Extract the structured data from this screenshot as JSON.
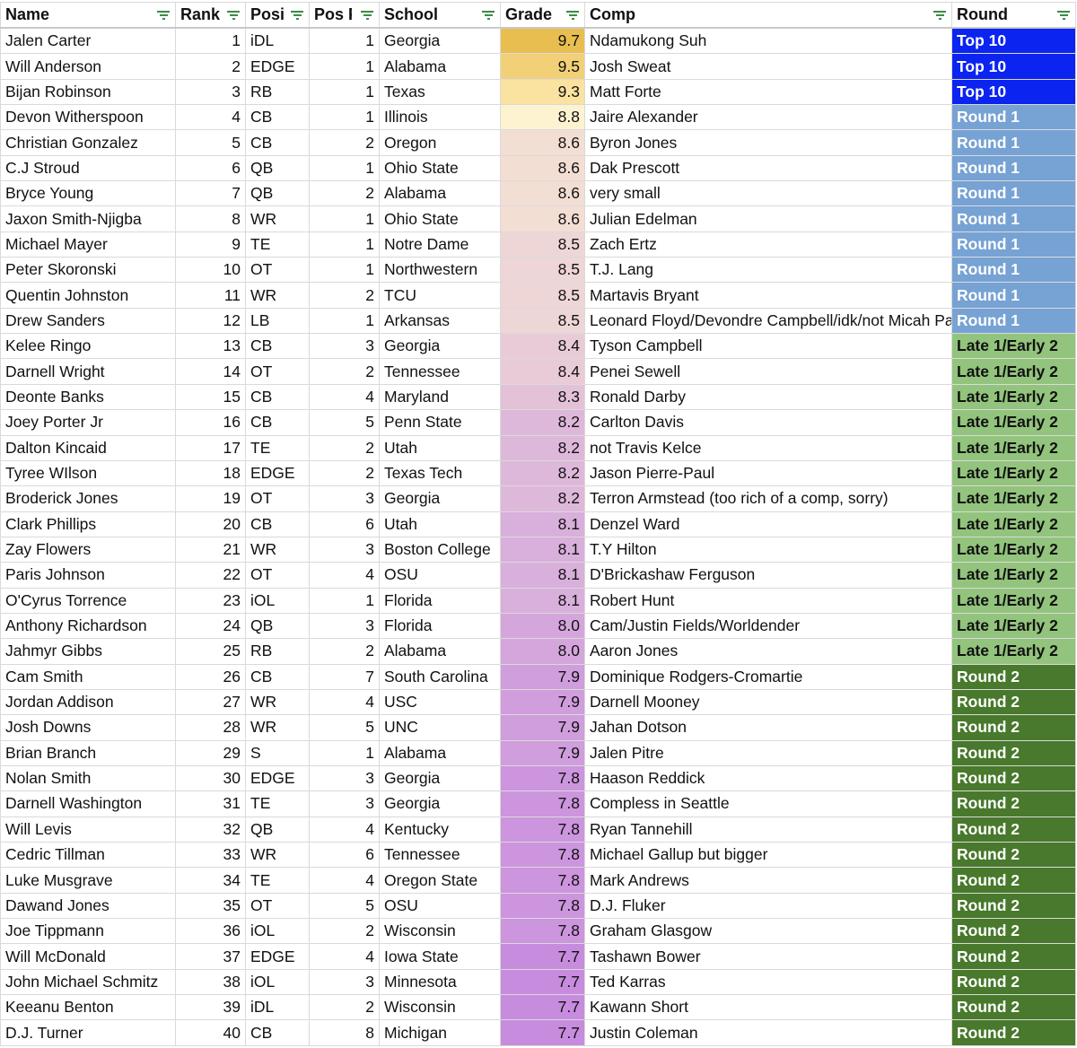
{
  "headers": {
    "name": "Name",
    "rank": "Rank",
    "position": "Posi",
    "pos_rank": "Pos F",
    "school": "School",
    "grade": "Grade",
    "comp": "Comp",
    "round": "Round"
  },
  "round_colors": {
    "Top 10": "#0b24f0",
    "Round 1": "#77a2d4",
    "Late 1/Early 2": "#93c47d",
    "Round 2": "#48792c"
  },
  "rows": [
    {
      "name": "Jalen Carter",
      "rank": "1",
      "pos": "iDL",
      "pos_rank": "1",
      "school": "Georgia",
      "grade": "9.7",
      "comp": "Ndamukong Suh",
      "round": "Top 10"
    },
    {
      "name": "Will Anderson",
      "rank": "2",
      "pos": "EDGE",
      "pos_rank": "1",
      "school": "Alabama",
      "grade": "9.5",
      "comp": "Josh Sweat",
      "round": "Top 10"
    },
    {
      "name": "Bijan Robinson",
      "rank": "3",
      "pos": "RB",
      "pos_rank": "1",
      "school": "Texas",
      "grade": "9.3",
      "comp": "Matt Forte",
      "round": "Top 10"
    },
    {
      "name": "Devon Witherspoon",
      "rank": "4",
      "pos": "CB",
      "pos_rank": "1",
      "school": "Illinois",
      "grade": "8.8",
      "comp": "Jaire Alexander",
      "round": "Round 1"
    },
    {
      "name": "Christian Gonzalez",
      "rank": "5",
      "pos": "CB",
      "pos_rank": "2",
      "school": "Oregon",
      "grade": "8.6",
      "comp": "Byron Jones",
      "round": "Round 1"
    },
    {
      "name": "C.J Stroud",
      "rank": "6",
      "pos": "QB",
      "pos_rank": "1",
      "school": "Ohio State",
      "grade": "8.6",
      "comp": "Dak Prescott",
      "round": "Round 1"
    },
    {
      "name": "Bryce Young",
      "rank": "7",
      "pos": "QB",
      "pos_rank": "2",
      "school": "Alabama",
      "grade": "8.6",
      "comp": "very small",
      "round": "Round 1"
    },
    {
      "name": "Jaxon Smith-Njigba",
      "rank": "8",
      "pos": "WR",
      "pos_rank": "1",
      "school": "Ohio State",
      "grade": "8.6",
      "comp": "Julian Edelman",
      "round": "Round 1"
    },
    {
      "name": "Michael Mayer",
      "rank": "9",
      "pos": "TE",
      "pos_rank": "1",
      "school": "Notre Dame",
      "grade": "8.5",
      "comp": "Zach Ertz",
      "round": "Round 1"
    },
    {
      "name": "Peter Skoronski",
      "rank": "10",
      "pos": "OT",
      "pos_rank": "1",
      "school": "Northwestern",
      "grade": "8.5",
      "comp": "T.J. Lang",
      "round": "Round 1"
    },
    {
      "name": "Quentin Johnston",
      "rank": "11",
      "pos": "WR",
      "pos_rank": "2",
      "school": "TCU",
      "grade": "8.5",
      "comp": "Martavis Bryant",
      "round": "Round 1"
    },
    {
      "name": "Drew Sanders",
      "rank": "12",
      "pos": "LB",
      "pos_rank": "1",
      "school": "Arkansas",
      "grade": "8.5",
      "comp": "Leonard Floyd/Devondre Campbell/idk/not Micah Parsons",
      "round": "Round 1"
    },
    {
      "name": "Kelee Ringo",
      "rank": "13",
      "pos": "CB",
      "pos_rank": "3",
      "school": "Georgia",
      "grade": "8.4",
      "comp": "Tyson Campbell",
      "round": "Late 1/Early 2"
    },
    {
      "name": "Darnell Wright",
      "rank": "14",
      "pos": "OT",
      "pos_rank": "2",
      "school": "Tennessee",
      "grade": "8.4",
      "comp": "Penei Sewell",
      "round": "Late 1/Early 2"
    },
    {
      "name": "Deonte Banks",
      "rank": "15",
      "pos": "CB",
      "pos_rank": "4",
      "school": "Maryland",
      "grade": "8.3",
      "comp": "Ronald Darby",
      "round": "Late 1/Early 2"
    },
    {
      "name": "Joey Porter Jr",
      "rank": "16",
      "pos": "CB",
      "pos_rank": "5",
      "school": "Penn State",
      "grade": "8.2",
      "comp": "Carlton Davis",
      "round": "Late 1/Early 2"
    },
    {
      "name": "Dalton Kincaid",
      "rank": "17",
      "pos": "TE",
      "pos_rank": "2",
      "school": "Utah",
      "grade": "8.2",
      "comp": "not Travis Kelce",
      "round": "Late 1/Early 2"
    },
    {
      "name": "Tyree WIlson",
      "rank": "18",
      "pos": "EDGE",
      "pos_rank": "2",
      "school": "Texas Tech",
      "grade": "8.2",
      "comp": "Jason Pierre-Paul",
      "round": "Late 1/Early 2"
    },
    {
      "name": "Broderick Jones",
      "rank": "19",
      "pos": "OT",
      "pos_rank": "3",
      "school": "Georgia",
      "grade": "8.2",
      "comp": "Terron Armstead (too rich of a comp, sorry)",
      "round": "Late 1/Early 2"
    },
    {
      "name": "Clark Phillips",
      "rank": "20",
      "pos": "CB",
      "pos_rank": "6",
      "school": "Utah",
      "grade": "8.1",
      "comp": "Denzel Ward",
      "round": "Late 1/Early 2"
    },
    {
      "name": "Zay Flowers",
      "rank": "21",
      "pos": "WR",
      "pos_rank": "3",
      "school": "Boston College",
      "grade": "8.1",
      "comp": "T.Y Hilton",
      "round": "Late 1/Early 2"
    },
    {
      "name": "Paris Johnson",
      "rank": "22",
      "pos": "OT",
      "pos_rank": "4",
      "school": "OSU",
      "grade": "8.1",
      "comp": "D'Brickashaw Ferguson",
      "round": "Late 1/Early 2"
    },
    {
      "name": "O'Cyrus Torrence",
      "rank": "23",
      "pos": "iOL",
      "pos_rank": "1",
      "school": "Florida",
      "grade": "8.1",
      "comp": "Robert Hunt",
      "round": "Late 1/Early 2"
    },
    {
      "name": "Anthony Richardson",
      "rank": "24",
      "pos": "QB",
      "pos_rank": "3",
      "school": "Florida",
      "grade": "8.0",
      "comp": "Cam/Justin Fields/Worldender",
      "round": "Late 1/Early 2"
    },
    {
      "name": "Jahmyr Gibbs",
      "rank": "25",
      "pos": "RB",
      "pos_rank": "2",
      "school": "Alabama",
      "grade": "8.0",
      "comp": "Aaron Jones",
      "round": "Late 1/Early 2"
    },
    {
      "name": "Cam Smith",
      "rank": "26",
      "pos": "CB",
      "pos_rank": "7",
      "school": "South Carolina",
      "grade": "7.9",
      "comp": "Dominique Rodgers-Cromartie",
      "round": "Round 2"
    },
    {
      "name": "Jordan Addison",
      "rank": "27",
      "pos": "WR",
      "pos_rank": "4",
      "school": "USC",
      "grade": "7.9",
      "comp": "Darnell Mooney",
      "round": "Round 2"
    },
    {
      "name": "Josh Downs",
      "rank": "28",
      "pos": "WR",
      "pos_rank": "5",
      "school": "UNC",
      "grade": "7.9",
      "comp": "Jahan Dotson",
      "round": "Round 2"
    },
    {
      "name": "Brian Branch",
      "rank": "29",
      "pos": "S",
      "pos_rank": "1",
      "school": "Alabama",
      "grade": "7.9",
      "comp": "Jalen Pitre",
      "round": "Round 2"
    },
    {
      "name": "Nolan Smith",
      "rank": "30",
      "pos": "EDGE",
      "pos_rank": "3",
      "school": "Georgia",
      "grade": "7.8",
      "comp": "Haason Reddick",
      "round": "Round 2"
    },
    {
      "name": "Darnell Washington",
      "rank": "31",
      "pos": "TE",
      "pos_rank": "3",
      "school": "Georgia",
      "grade": "7.8",
      "comp": "Compless in Seattle",
      "round": "Round 2"
    },
    {
      "name": "Will Levis",
      "rank": "32",
      "pos": "QB",
      "pos_rank": "4",
      "school": "Kentucky",
      "grade": "7.8",
      "comp": "Ryan Tannehill",
      "round": "Round 2"
    },
    {
      "name": "Cedric Tillman",
      "rank": "33",
      "pos": "WR",
      "pos_rank": "6",
      "school": "Tennessee",
      "grade": "7.8",
      "comp": "Michael Gallup but bigger",
      "round": "Round 2"
    },
    {
      "name": "Luke Musgrave",
      "rank": "34",
      "pos": "TE",
      "pos_rank": "4",
      "school": "Oregon State",
      "grade": "7.8",
      "comp": "Mark Andrews",
      "round": "Round 2"
    },
    {
      "name": "Dawand Jones",
      "rank": "35",
      "pos": "OT",
      "pos_rank": "5",
      "school": "OSU",
      "grade": "7.8",
      "comp": "D.J. Fluker",
      "round": "Round 2"
    },
    {
      "name": "Joe Tippmann",
      "rank": "36",
      "pos": "iOL",
      "pos_rank": "2",
      "school": "Wisconsin",
      "grade": "7.8",
      "comp": "Graham Glasgow",
      "round": "Round 2"
    },
    {
      "name": "Will McDonald",
      "rank": "37",
      "pos": "EDGE",
      "pos_rank": "4",
      "school": "Iowa State",
      "grade": "7.7",
      "comp": "Tashawn Bower",
      "round": "Round 2"
    },
    {
      "name": "John Michael Schmitz",
      "rank": "38",
      "pos": "iOL",
      "pos_rank": "3",
      "school": "Minnesota",
      "grade": "7.7",
      "comp": "Ted Karras",
      "round": "Round 2"
    },
    {
      "name": "Keeanu Benton",
      "rank": "39",
      "pos": "iDL",
      "pos_rank": "2",
      "school": "Wisconsin",
      "grade": "7.7",
      "comp": "Kawann Short",
      "round": "Round 2"
    },
    {
      "name": "D.J. Turner",
      "rank": "40",
      "pos": "CB",
      "pos_rank": "8",
      "school": "Michigan",
      "grade": "7.7",
      "comp": "Justin Coleman",
      "round": "Round 2"
    }
  ]
}
